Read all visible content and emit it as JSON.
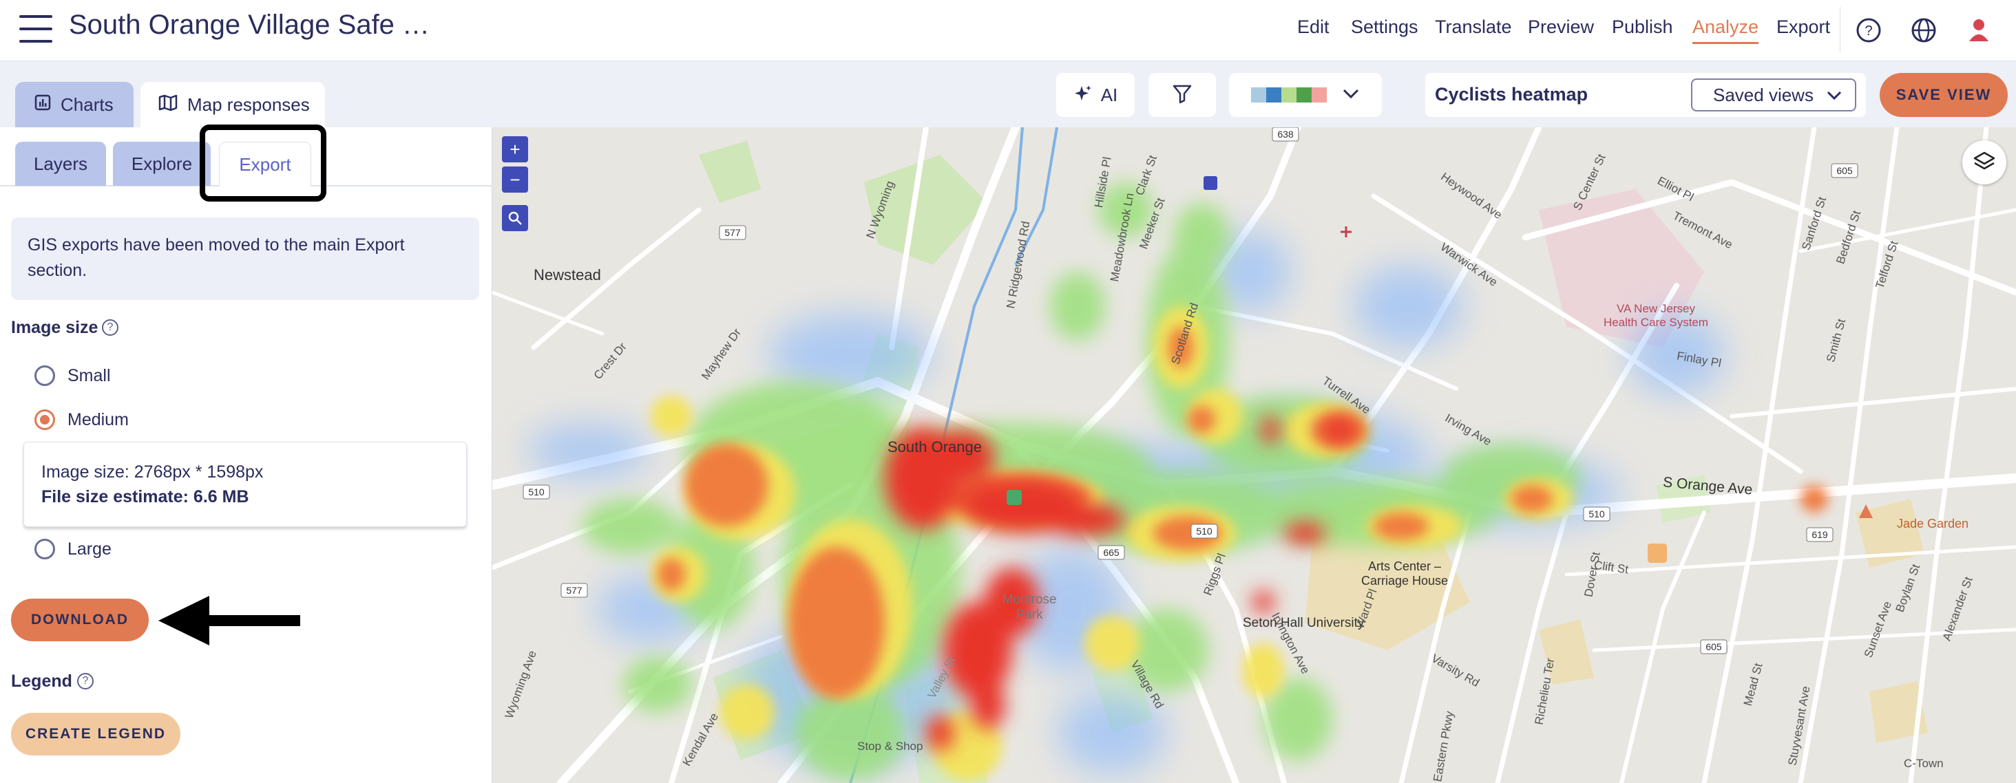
{
  "header": {
    "title": "South Orange Village Safe …",
    "nav": [
      "Edit",
      "Settings",
      "Translate",
      "Preview",
      "Publish",
      "Analyze",
      "Export"
    ],
    "active_nav": "Analyze",
    "icons": [
      "help-icon",
      "globe-icon",
      "user-icon"
    ]
  },
  "toolbar": {
    "tab_charts": "Charts",
    "tab_map": "Map responses",
    "ai_label": "AI",
    "view_name": "Cyclists heatmap",
    "saved_views": "Saved views",
    "save_view": "SAVE VIEW",
    "palette": [
      "#a9cbe0",
      "#3a7fc1",
      "#b6dd8f",
      "#4ea14a",
      "#f2a3a0"
    ]
  },
  "panel": {
    "subtabs": [
      "Layers",
      "Explore",
      "Export"
    ],
    "active_subtab": "Export",
    "info": "GIS exports have been moved to the main Export section.",
    "image_size_label": "Image size",
    "sizes": [
      "Small",
      "Medium",
      "Large"
    ],
    "selected_size": "Medium",
    "size_detail": "Image size: 2768px * 1598px",
    "file_estimate": "File size estimate: 6.6 MB",
    "download": "DOWNLOAD",
    "legend_label": "Legend",
    "create_legend": "CREATE LEGEND"
  },
  "map": {
    "places": [
      "Newstead",
      "South Orange",
      "Montrose Park",
      "Seton Hall University",
      "Arts Center – Carriage House",
      "VA New Jersey Health Care System",
      "Jade Garden",
      "Stop & Shop",
      "C-Town"
    ],
    "streets": [
      "N Wyoming",
      "Hillside Pl",
      "Meadowbrook Ln",
      "Clark St",
      "Meeker St",
      "N Ridgewood Rd",
      "Scotland Rd",
      "Warwick Ave",
      "Heywood Ave",
      "S Center St",
      "Elliot Pl",
      "Tremont Ave",
      "Sanford St",
      "Bedford St",
      "Telford St",
      "Turrell Ave",
      "Irving Ave",
      "Finlay Pl",
      "Smith St",
      "S Orange Ave",
      "Riggs Pl",
      "Irvington Ave",
      "Village Rd",
      "Valley St",
      "Ward Pl",
      "Varsity Rd",
      "Clift St",
      "Dover St",
      "Mayhew Dr",
      "Crest Dr",
      "Kendal Ave",
      "Wyoming Ave",
      "Mead St",
      "Stuyvesant Ave",
      "Sunset Ave",
      "Boylan St",
      "Alexander St",
      "Eastern Pkwy",
      "Richelieu Ter"
    ],
    "route_shields": [
      "638",
      "577",
      "510",
      "510",
      "510",
      "665",
      "577",
      "605",
      "619",
      "605"
    ]
  }
}
